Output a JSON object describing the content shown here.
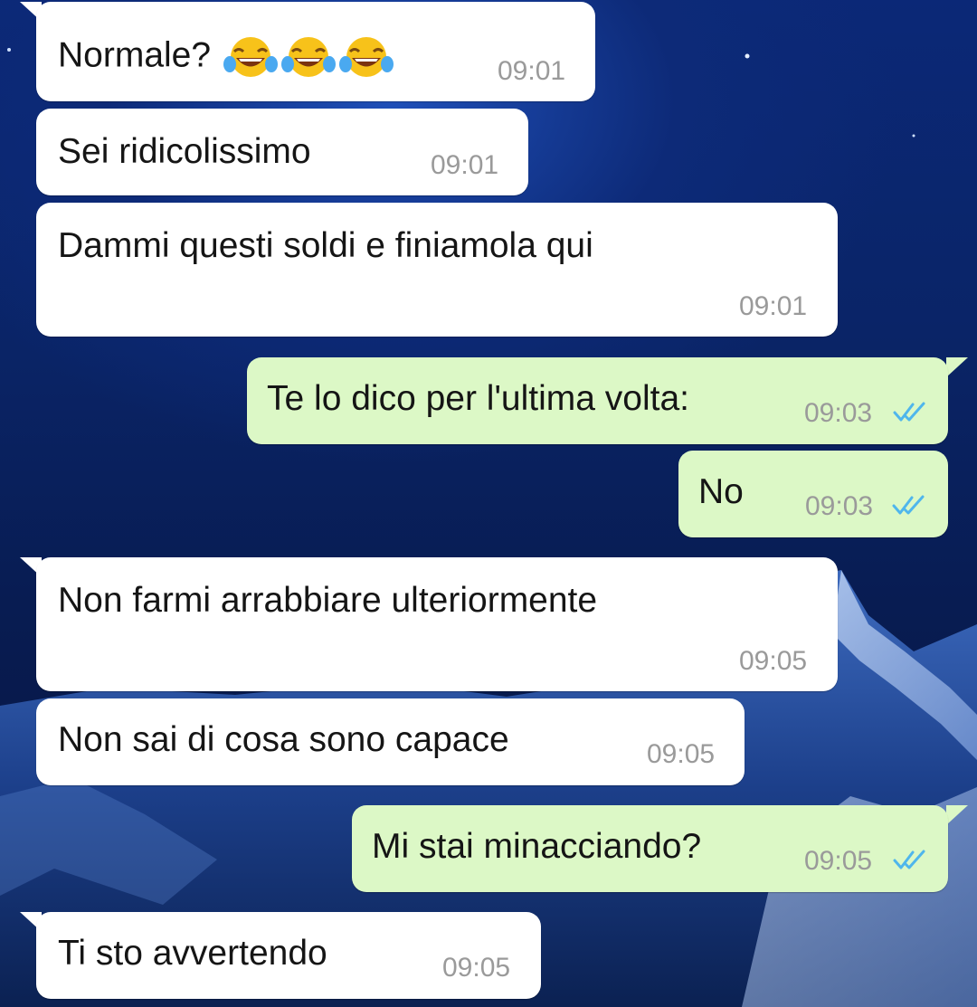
{
  "chat": {
    "messages": [
      {
        "direction": "incoming",
        "text": "Normale?",
        "emoji": [
          "face-with-tears-of-joy",
          "face-with-tears-of-joy",
          "face-with-tears-of-joy"
        ],
        "time": "09:01"
      },
      {
        "direction": "incoming",
        "text": "Sei ridicolissimo",
        "time": "09:01"
      },
      {
        "direction": "incoming",
        "text": "Dammi questi soldi e finiamola qui",
        "time": "09:01"
      },
      {
        "direction": "outgoing",
        "text": "Te lo dico per l'ultima volta:",
        "time": "09:03",
        "status": "read"
      },
      {
        "direction": "outgoing",
        "text": "No",
        "time": "09:03",
        "status": "read"
      },
      {
        "direction": "incoming",
        "text": "Non farmi arrabbiare ulteriormente",
        "time": "09:05"
      },
      {
        "direction": "incoming",
        "text": "Non sai di cosa sono capace",
        "time": "09:05"
      },
      {
        "direction": "outgoing",
        "text": "Mi stai minacciando?",
        "time": "09:05",
        "status": "read"
      },
      {
        "direction": "incoming",
        "text": "Ti sto avvertendo",
        "time": "09:05"
      }
    ]
  },
  "colors": {
    "incoming_bubble": "#ffffff",
    "outgoing_bubble": "#dcf8c6",
    "read_tick": "#4fb6ec",
    "timestamp": "#9a9a9a"
  },
  "wallpaper": "night-sky-snowy-mountain"
}
